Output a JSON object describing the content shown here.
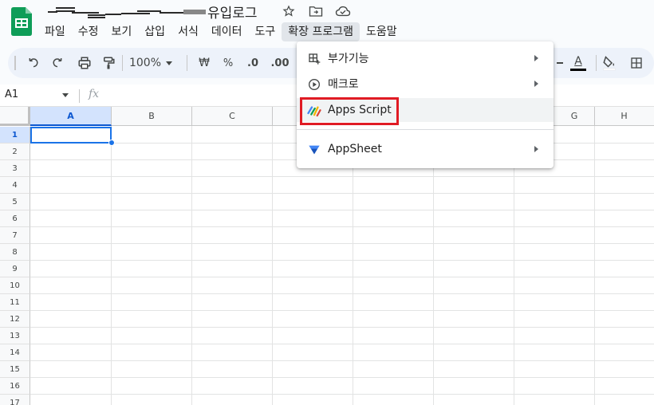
{
  "title": {
    "suffix_text": "유입로그"
  },
  "menu": {
    "items": [
      "파일",
      "수정",
      "보기",
      "삽입",
      "서식",
      "데이터",
      "도구",
      "확장 프로그램",
      "도움말"
    ]
  },
  "toolbar": {
    "zoom": "100%",
    "currency": "₩",
    "percent": "%",
    "decrease_decimal": ".0",
    "increase_decimal": ".00",
    "text_color_label": "A"
  },
  "formula_bar": {
    "cell_ref": "A1",
    "fx": "fx"
  },
  "grid": {
    "columns": [
      "A",
      "B",
      "C",
      "G",
      "H"
    ],
    "rows": [
      "1",
      "2",
      "3",
      "4",
      "5",
      "6",
      "7",
      "8",
      "9",
      "10",
      "11",
      "12",
      "13",
      "14",
      "15",
      "16",
      "17"
    ]
  },
  "extensions_menu": {
    "items": [
      {
        "label": "부가기능",
        "icon": "addons-icon",
        "submenu": true
      },
      {
        "label": "매크로",
        "icon": "macro-play-icon",
        "submenu": true
      },
      {
        "label": "Apps Script",
        "icon": "apps-script-icon",
        "submenu": false
      },
      {
        "label": "AppSheet",
        "icon": "appsheet-icon",
        "submenu": true
      }
    ]
  },
  "colors": {
    "accent": "#1a73e8",
    "sheets_green": "#0f9d58",
    "highlight_red": "#e01b24"
  }
}
